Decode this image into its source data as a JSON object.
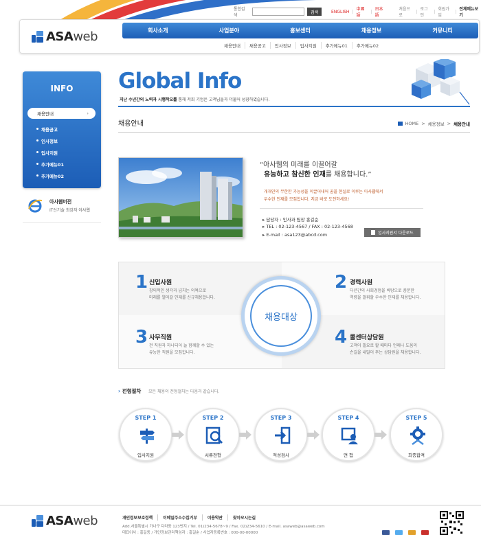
{
  "utility": {
    "search_label": "통합검색",
    "search_value": "",
    "search_button": "검색",
    "lang_english": "ENGLISH",
    "lang_chinese": "中國語",
    "lang_japanese": "日本語",
    "links": [
      "처음으로",
      "로그인",
      "회원가입"
    ],
    "sitemap": "전체메뉴보기"
  },
  "logo": {
    "brand_bold": "ASA",
    "brand_light": "web"
  },
  "main_nav": [
    "회사소개",
    "사업분야",
    "홍보센터",
    "채용정보",
    "커뮤니티"
  ],
  "sub_nav": [
    "채용안내",
    "채용공고",
    "인사정보",
    "입사지원",
    "추가메뉴01",
    "추가메뉴02"
  ],
  "sidebar": {
    "title": "INFO",
    "active_item": "채용안내",
    "active_arrow": "›",
    "items": [
      "채용공고",
      "인사정보",
      "입사지원",
      "추가메뉴01",
      "추가메뉴02"
    ]
  },
  "ie_promo": {
    "title": "아사웹버전",
    "subtitle": "IT신기술 최강자 아사웹"
  },
  "banner": {
    "title": "Global Info",
    "subtitle_bold": "지난 수년간의 노력과 시행착오를",
    "subtitle_rest": " 통해 저희 기업은 고객님들과 더불어 성장하였습니다."
  },
  "page": {
    "heading": "채용안내",
    "breadcrumb": [
      "HOME",
      "채용정보",
      "채용안내"
    ],
    "breadcrumb_sep": ">"
  },
  "intro": {
    "quote_line1": "“아사웹의 미래를 이끌어갈",
    "quote_line2_bold": "유능하고 참신한 인재",
    "quote_line2_rest": "를 채용합니다.”",
    "desc_line1": "개개인의 무한한 가능성을 이끌어내어 꿈을 현실로 이루는 아사웹에서",
    "desc_line2": "우수한 인재를 모집합니다. 지금 바로 도전하세요!",
    "contact_manager": "담당자 : 인사과 팀장 홍길순",
    "contact_phone": "TEL : 02-123-4567 / FAX : 02-123-4568",
    "contact_email": "E-mail : asa123@abcd.com",
    "download_button": "입사지원서 다운로드"
  },
  "target": {
    "center_label": "채용대상",
    "groups": [
      {
        "num": "1",
        "title": "신입사원",
        "desc1": "창의적인 생각과 넘치는 의욕으로",
        "desc2": "미래를 열어갈 인재를 신규채용합니다."
      },
      {
        "num": "2",
        "title": "경력사원",
        "desc1": "다년간의 사회경험을 바탕으로 충분한",
        "desc2": "역량을 발휘할 우수한 인재를 채용합니다."
      },
      {
        "num": "3",
        "title": "사무직원",
        "desc1": "전 직원과 하나되어 늘 함께할 수 있는",
        "desc2": "유능한 직원을 모집합니다."
      },
      {
        "num": "4",
        "title": "콜센터상담원",
        "desc1": "고객이 필요로 할 때마다 언제나 도움의",
        "desc2": "손길을 내밀어 주는 상담원을 채용합니다."
      }
    ]
  },
  "process": {
    "heading": "전형절차",
    "subtitle": "모든 채용의 전형절차는 다음과 같습니다.",
    "steps": [
      {
        "step": "STEP 1",
        "label": "입사지원"
      },
      {
        "step": "STEP 2",
        "label": "서류전형"
      },
      {
        "step": "STEP 3",
        "label": "적성검사"
      },
      {
        "step": "STEP 4",
        "label": "면  접"
      },
      {
        "step": "STEP 5",
        "label": "최종합격"
      }
    ]
  },
  "footer": {
    "links": [
      "개인정보보호정책",
      "이메일주소수집거부",
      "이용약관",
      "찾아오시는길"
    ],
    "address": "Add.서울특별시 가나구 다라동 123번지 / Tel. 01)234-5678~9 / Fax. 02)234-5610 / E-mail. asaweb@asaweb.com",
    "info": "대표이사 : 홍길동 / 개인정보관리책임자 : 홍길순 / 사업자등록번호 : 000-00-00000"
  },
  "colors": {
    "primary": "#1c5db6",
    "accent": "#2b74c8",
    "lang_red": "#dd2222",
    "desc_orange": "#c06030"
  }
}
